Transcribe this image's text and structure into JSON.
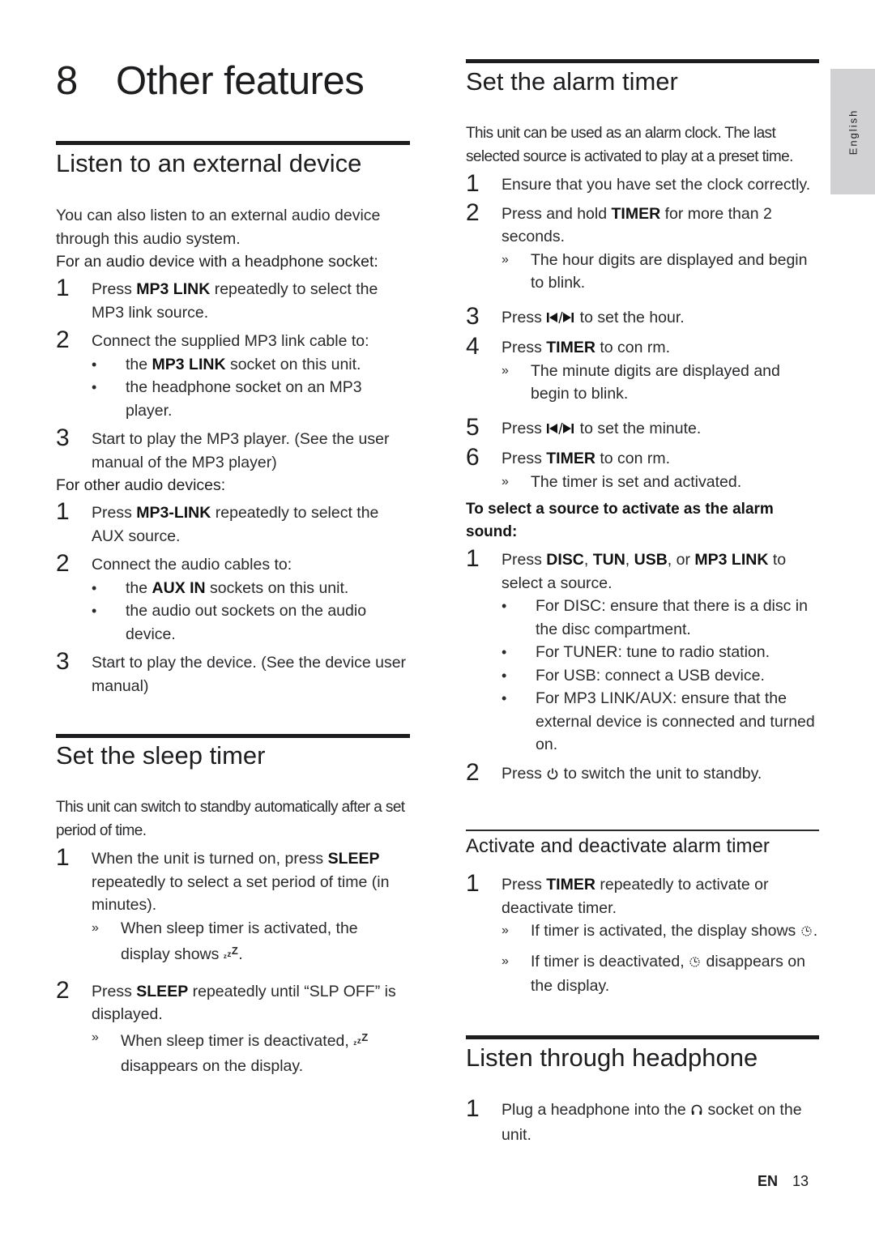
{
  "chapter": {
    "number": "8",
    "title": "Other features"
  },
  "lang_tab": "English",
  "footer": {
    "lang": "EN",
    "page": "13"
  },
  "external": {
    "title": "Listen to an external device",
    "intro": "You can also listen to an external audio device through this audio system.",
    "headphone_heading": "For an audio device with a headphone socket:",
    "headphone_steps": [
      {
        "n": "1",
        "pre": "Press ",
        "bold": "MP3 LINK",
        "post": " repeatedly to select the MP3 link source."
      },
      {
        "n": "2",
        "text": "Connect the supplied MP3 link cable to:"
      },
      {
        "n": "3",
        "text": "Start to play the MP3 player. (See the user manual of the MP3 player)"
      }
    ],
    "headphone_bullets": [
      {
        "pre": "the ",
        "bold": "MP3 LINK",
        "post": " socket on this unit."
      },
      {
        "text": "the headphone socket on an MP3 player."
      }
    ],
    "other_heading": "For other audio devices:",
    "other_steps": [
      {
        "n": "1",
        "pre": "Press ",
        "bold": "MP3-LINK",
        "post": " repeatedly to select the AUX source."
      },
      {
        "n": "2",
        "text": "Connect the audio cables to:"
      },
      {
        "n": "3",
        "text": "Start to play the device. (See the device user manual)"
      }
    ],
    "other_bullets": [
      {
        "pre": "the ",
        "bold": "AUX IN",
        "post": " sockets on this unit."
      },
      {
        "text": "the audio out sockets on the audio device."
      }
    ]
  },
  "sleep": {
    "title": "Set the sleep timer",
    "intro": "This unit can switch to standby automatically after a set period of time.",
    "steps": [
      {
        "n": "1",
        "pre": "When the unit is turned on, press ",
        "bold": "SLEEP",
        "post": " repeatedly to select a set period of time (in minutes)."
      },
      {
        "n": "2",
        "pre": "Press ",
        "bold": "SLEEP",
        "post": " repeatedly until “SLP OFF” is displayed."
      }
    ],
    "results": [
      {
        "pre": "When sleep timer is activated, the display shows ",
        "icon": "sleep-zzz-icon",
        "post": "."
      },
      {
        "pre": "When sleep timer is deactivated, ",
        "icon": "sleep-zzz-icon",
        "post": " disappears on the display."
      }
    ]
  },
  "alarm": {
    "title": "Set the alarm timer",
    "intro": "This unit can be used as an alarm clock. The last selected source is activated to play at a preset time.",
    "steps": [
      {
        "n": "1",
        "text": "Ensure that you have set the clock correctly."
      },
      {
        "n": "2",
        "pre": "Press and hold ",
        "bold": "TIMER",
        "post": " for more than 2 seconds."
      },
      {
        "n": "3",
        "pre": "Press ",
        "icon": "prev-next-icon",
        "post": " to set the hour."
      },
      {
        "n": "4",
        "pre": "Press ",
        "bold": "TIMER",
        "post": " to con  rm."
      },
      {
        "n": "5",
        "pre": "Press ",
        "icon": "prev-next-icon",
        "post": " to set the minute."
      },
      {
        "n": "6",
        "pre": "Press ",
        "bold": "TIMER",
        "post": " to con  rm."
      }
    ],
    "results": [
      "The hour digits are displayed and begin to blink.",
      "The minute digits are displayed and begin to blink.",
      "The timer is set and activated."
    ],
    "source_heading": "To select a source to activate as the alarm sound:",
    "source_steps": [
      {
        "n": "1",
        "pre": "Press ",
        "bold1": "DISC",
        "sep1": ", ",
        "bold2": "TUN",
        "sep2": ", ",
        "bold3": "USB",
        "sep3": ", or ",
        "bold4": "MP3 LINK",
        "post": " to select a source."
      },
      {
        "n": "2",
        "pre": "Press ",
        "icon": "power-standby-icon",
        "post": " to switch the unit to standby."
      }
    ],
    "source_bullets": [
      "For DISC: ensure that there is a disc in the disc compartment.",
      "For TUNER: tune to radio station.",
      "For USB: connect a USB device.",
      "For MP3 LINK/AUX: ensure that the external device is connected and turned on."
    ]
  },
  "activate": {
    "title": "Activate and deactivate alarm timer",
    "steps": [
      {
        "n": "1",
        "pre": "Press ",
        "bold": "TIMER",
        "post": " repeatedly to activate or deactivate timer."
      }
    ],
    "results": [
      {
        "pre": "If timer is activated, the display shows ",
        "icon": "alarm-timer-icon",
        "post": "."
      },
      {
        "pre": "If timer is deactivated, ",
        "icon": "alarm-timer-icon",
        "post": " disappears on the display."
      }
    ]
  },
  "headphone": {
    "title": "Listen through headphone",
    "steps": [
      {
        "n": "1",
        "pre": "Plug a headphone into the ",
        "icon": "headphone-icon",
        "post": " socket on the unit."
      }
    ]
  }
}
